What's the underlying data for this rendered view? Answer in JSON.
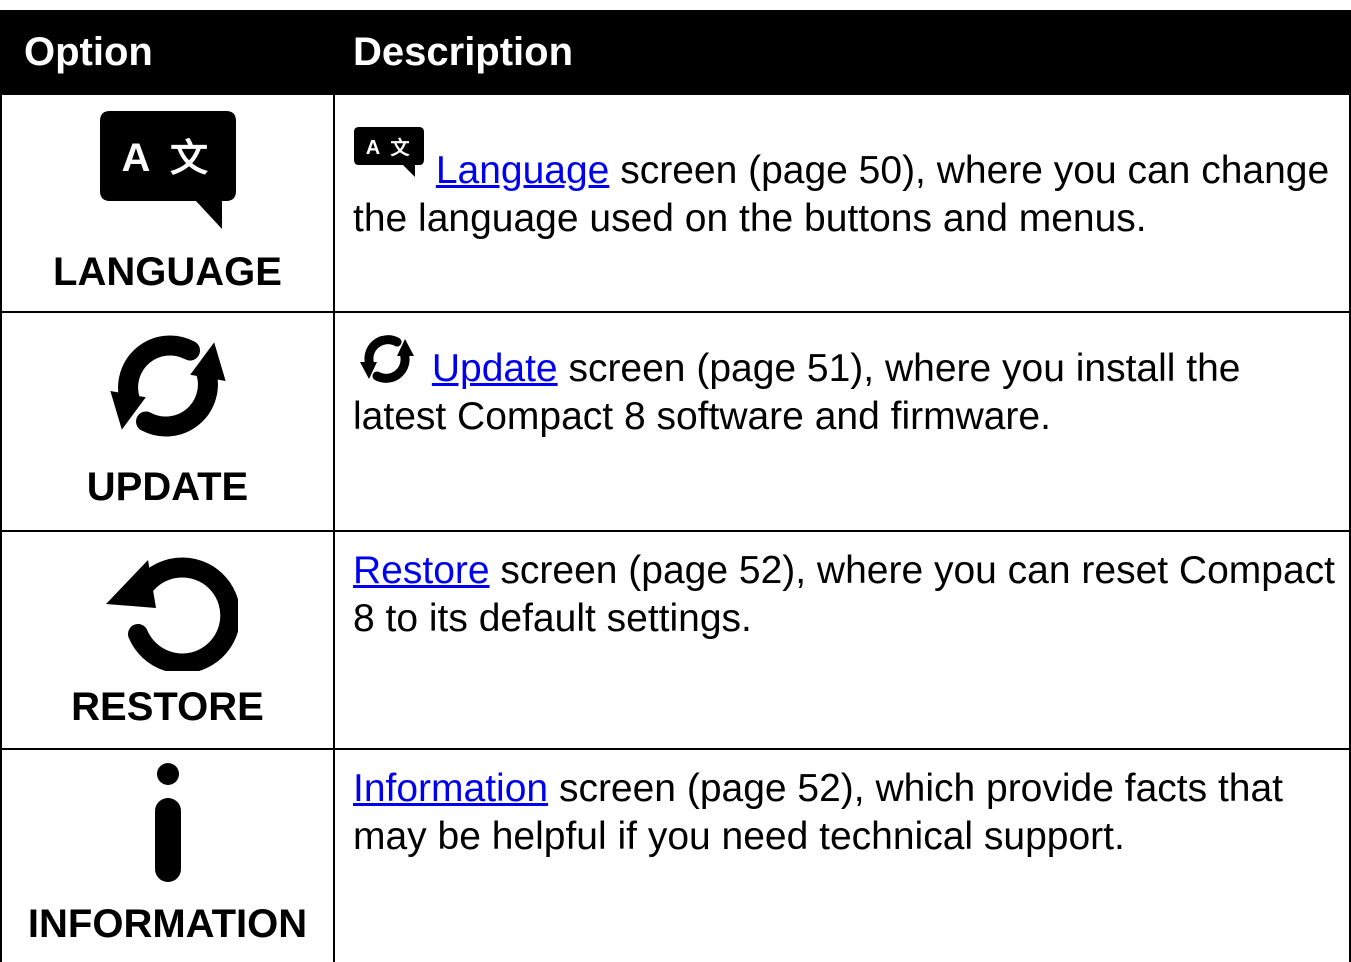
{
  "header": {
    "col_option": "Option",
    "col_description": "Description"
  },
  "rows": [
    {
      "label": "LANGUAGE",
      "icon": "language-icon",
      "link": "Language",
      "text_line": " screen (page 50), where you can change the language used on the buttons and menus."
    },
    {
      "label": "UPDATE",
      "icon": "update-icon",
      "link": "Update",
      "text_line": " screen (page 51), where you install the latest Compact 8 software and firmware."
    },
    {
      "label": "RESTORE",
      "icon": "restore-icon",
      "link": "Restore",
      "text_line": " screen (page 52), where you can reset Compact 8 to its default settings."
    },
    {
      "label": "INFORMATION",
      "icon": "information-icon",
      "link": "Information",
      "text_line": " screen (page 52), which provide facts that may be helpful if you need technical support."
    }
  ],
  "colors": {
    "link": "#0000ee",
    "header_bg": "#000000",
    "header_fg": "#ffffff"
  }
}
